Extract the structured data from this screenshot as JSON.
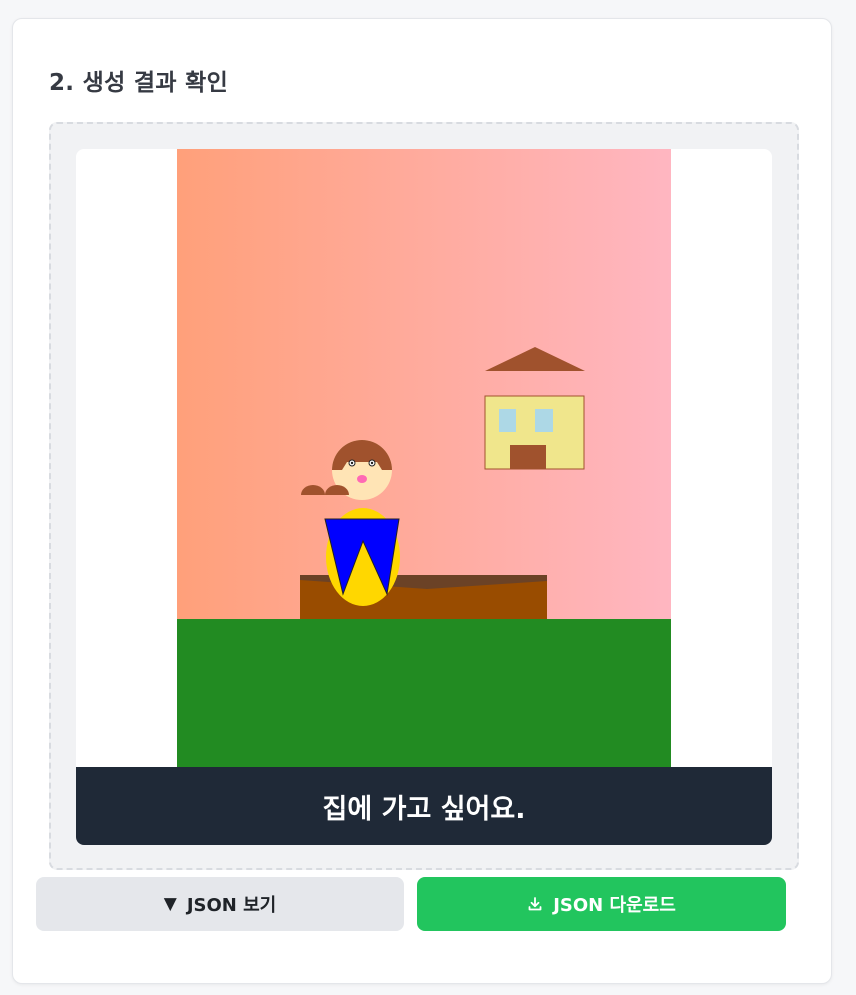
{
  "section": {
    "title": "2. 생성 결과 확인"
  },
  "preview": {
    "caption": "집에 가고 싶어요.",
    "scene_elements": {
      "sky": "sky-gradient",
      "ground": "grass-ground",
      "house": "house",
      "person": "person-figure",
      "table": "brown-table"
    }
  },
  "colors": {
    "sky_left": "#ffa07a",
    "sky_right": "#ffb6c1",
    "grass": "#228b22",
    "house_wall": "#f0e68c",
    "house_roof": "#a0522d",
    "window": "#add8e6",
    "table": "#994c00",
    "caption_bg": "#1f2937",
    "download_btn": "#22c55e",
    "view_btn": "#e5e7eb"
  },
  "buttons": {
    "view_icon": "triangle-down-icon",
    "view_label": "JSON 보기",
    "download_icon": "download-icon",
    "download_label": "JSON 다운로드"
  }
}
